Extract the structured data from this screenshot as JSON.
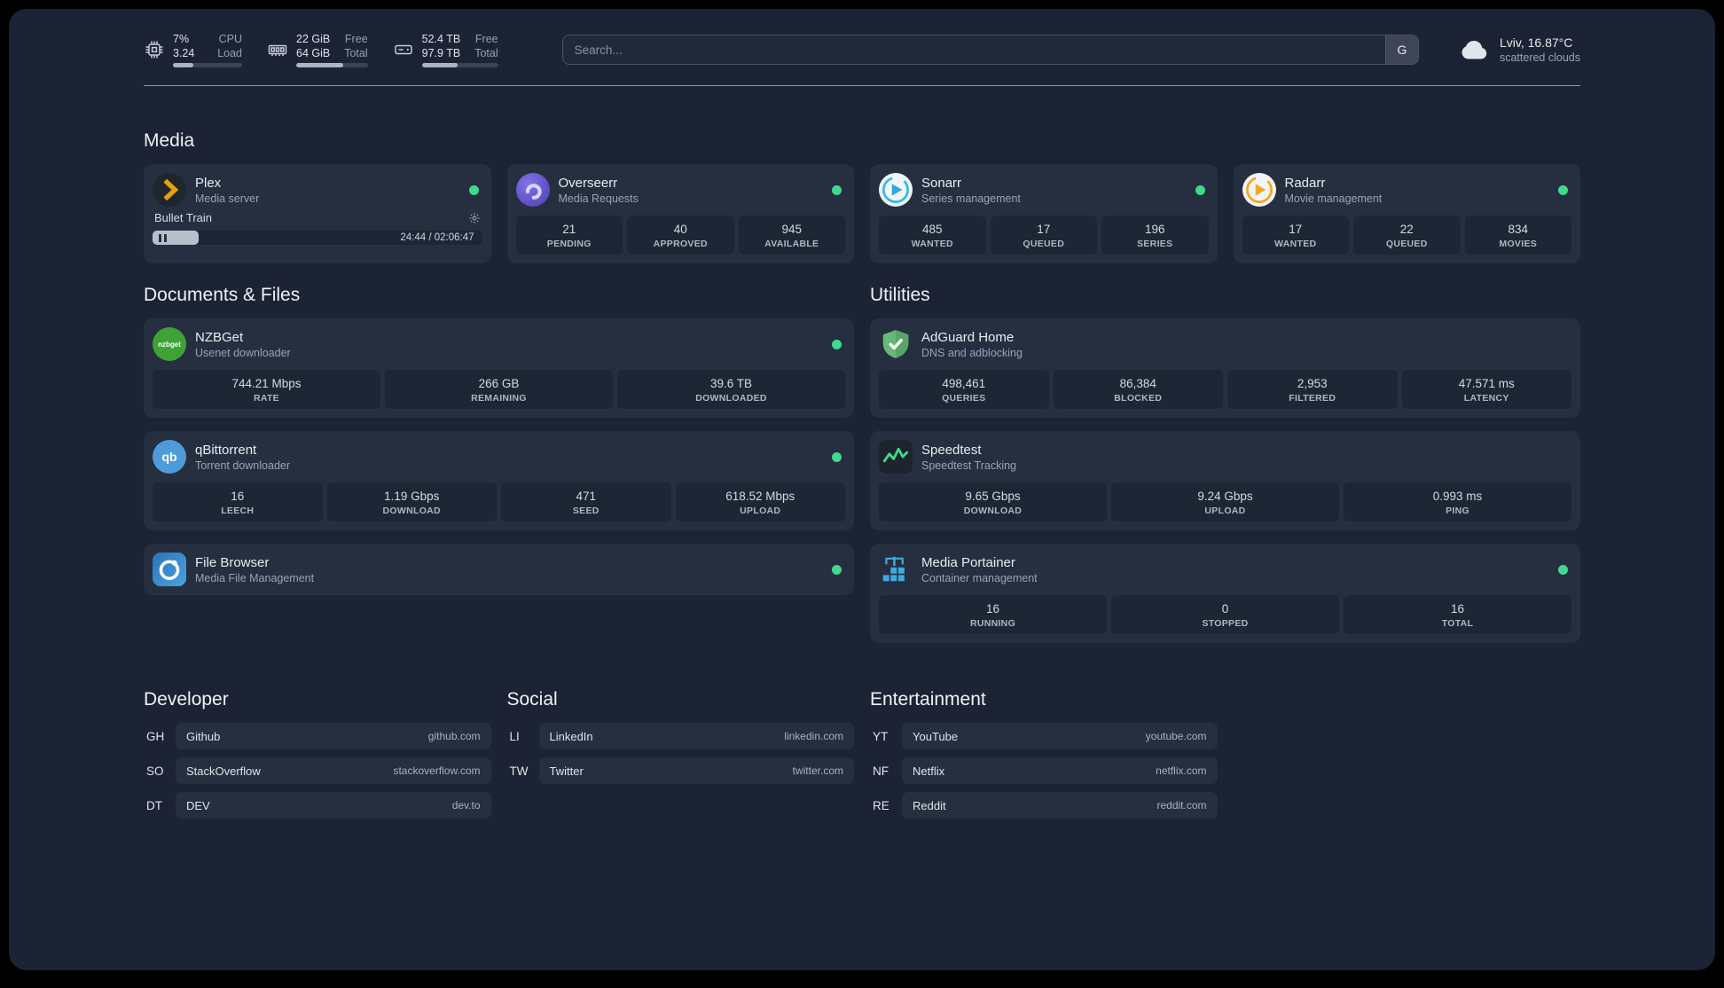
{
  "colors": {
    "background": "#1b2334",
    "card": "#252f40",
    "status_online": "#41d98c",
    "plex_accent": "#e5a00d"
  },
  "topbar": {
    "cpu": {
      "value1": "7%",
      "label1": "CPU",
      "value2": "3.24",
      "label2": "Load",
      "progress_pct": 30
    },
    "memory": {
      "value1": "22 GiB",
      "label1": "Free",
      "value2": "64 GiB",
      "label2": "Total",
      "progress_pct": 66
    },
    "disk": {
      "value1": "52.4 TB",
      "label1": "Free",
      "value2": "97.9 TB",
      "label2": "Total",
      "progress_pct": 47
    },
    "search": {
      "placeholder": "Search...",
      "provider_label": "G"
    },
    "weather": {
      "location": "Lviv, 16.87°C",
      "condition": "scattered clouds"
    }
  },
  "sections": {
    "media": {
      "title": "Media",
      "plex": {
        "name": "Plex",
        "desc": "Media server",
        "status": "online",
        "player": {
          "title": "Bullet Train",
          "time": "24:44 / 02:06:47",
          "progress_pct": 14
        }
      },
      "overseerr": {
        "name": "Overseerr",
        "desc": "Media Requests",
        "status": "online",
        "stats": [
          {
            "value": "21",
            "label": "PENDING"
          },
          {
            "value": "40",
            "label": "APPROVED"
          },
          {
            "value": "945",
            "label": "AVAILABLE"
          }
        ]
      },
      "sonarr": {
        "name": "Sonarr",
        "desc": "Series management",
        "status": "online",
        "stats": [
          {
            "value": "485",
            "label": "WANTED"
          },
          {
            "value": "17",
            "label": "QUEUED"
          },
          {
            "value": "196",
            "label": "SERIES"
          }
        ]
      },
      "radarr": {
        "name": "Radarr",
        "desc": "Movie management",
        "status": "online",
        "stats": [
          {
            "value": "17",
            "label": "WANTED"
          },
          {
            "value": "22",
            "label": "QUEUED"
          },
          {
            "value": "834",
            "label": "MOVIES"
          }
        ]
      }
    },
    "documents": {
      "title": "Documents & Files",
      "nzbget": {
        "name": "NZBGet",
        "desc": "Usenet downloader",
        "status": "online",
        "icon_label": "nzbget",
        "stats": [
          {
            "value": "744.21 Mbps",
            "label": "RATE"
          },
          {
            "value": "266 GB",
            "label": "REMAINING"
          },
          {
            "value": "39.6 TB",
            "label": "DOWNLOADED"
          }
        ]
      },
      "qbittorrent": {
        "name": "qBittorrent",
        "desc": "Torrent downloader",
        "status": "online",
        "icon_label": "qb",
        "stats": [
          {
            "value": "16",
            "label": "LEECH"
          },
          {
            "value": "1.19 Gbps",
            "label": "DOWNLOAD"
          },
          {
            "value": "471",
            "label": "SEED"
          },
          {
            "value": "618.52 Mbps",
            "label": "UPLOAD"
          }
        ]
      },
      "filebrowser": {
        "name": "File Browser",
        "desc": "Media File Management",
        "status": "online"
      }
    },
    "utilities": {
      "title": "Utilities",
      "adguard": {
        "name": "AdGuard Home",
        "desc": "DNS and adblocking",
        "stats": [
          {
            "value": "498,461",
            "label": "QUERIES"
          },
          {
            "value": "86,384",
            "label": "BLOCKED"
          },
          {
            "value": "2,953",
            "label": "FILTERED"
          },
          {
            "value": "47.571 ms",
            "label": "LATENCY"
          }
        ]
      },
      "speedtest": {
        "name": "Speedtest",
        "desc": "Speedtest Tracking",
        "stats": [
          {
            "value": "9.65 Gbps",
            "label": "DOWNLOAD"
          },
          {
            "value": "9.24 Gbps",
            "label": "UPLOAD"
          },
          {
            "value": "0.993 ms",
            "label": "PING"
          }
        ]
      },
      "portainer": {
        "name": "Media Portainer",
        "desc": "Container management",
        "status": "online",
        "stats": [
          {
            "value": "16",
            "label": "RUNNING"
          },
          {
            "value": "0",
            "label": "STOPPED"
          },
          {
            "value": "16",
            "label": "TOTAL"
          }
        ]
      }
    },
    "bookmarks": [
      {
        "title": "Developer",
        "items": [
          {
            "abbr": "GH",
            "name": "Github",
            "domain": "github.com"
          },
          {
            "abbr": "SO",
            "name": "StackOverflow",
            "domain": "stackoverflow.com"
          },
          {
            "abbr": "DT",
            "name": "DEV",
            "domain": "dev.to"
          }
        ]
      },
      {
        "title": "Social",
        "items": [
          {
            "abbr": "LI",
            "name": "LinkedIn",
            "domain": "linkedin.com"
          },
          {
            "abbr": "TW",
            "name": "Twitter",
            "domain": "twitter.com"
          }
        ]
      },
      {
        "title": "Entertainment",
        "items": [
          {
            "abbr": "YT",
            "name": "YouTube",
            "domain": "youtube.com"
          },
          {
            "abbr": "NF",
            "name": "Netflix",
            "domain": "netflix.com"
          },
          {
            "abbr": "RE",
            "name": "Reddit",
            "domain": "reddit.com"
          }
        ]
      }
    ]
  }
}
